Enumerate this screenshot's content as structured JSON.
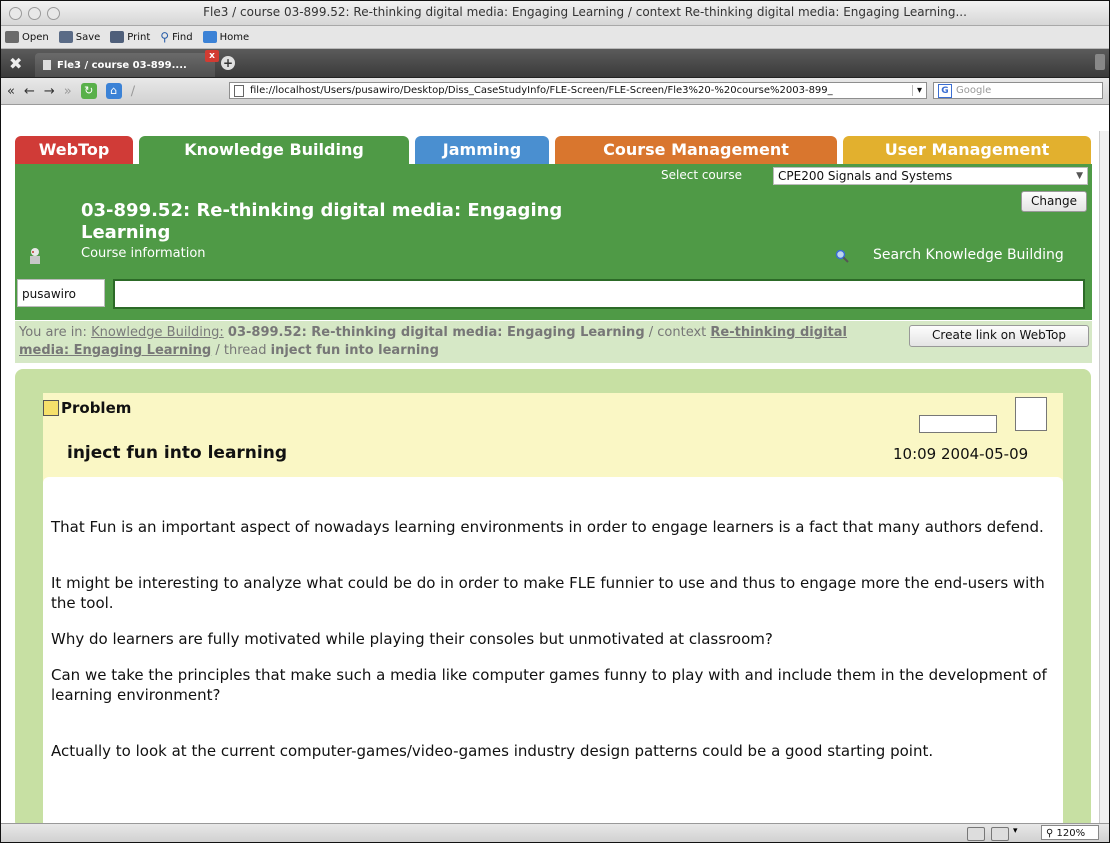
{
  "window": {
    "title": "Fle3 / course 03-899.52: Re-thinking digital media: Engaging Learning / context Re-thinking digital media: Engaging Learning..."
  },
  "bookmarks": [
    {
      "label": "Open",
      "icon": "folder-icon"
    },
    {
      "label": "Save",
      "icon": "save-icon"
    },
    {
      "label": "Print",
      "icon": "print-icon"
    },
    {
      "label": "Find",
      "icon": "search-icon"
    },
    {
      "label": "Home",
      "icon": "home-icon"
    }
  ],
  "browser_tab": {
    "label": "Fle3 / course 03-899....",
    "close": "x",
    "new_tab": "+"
  },
  "nav": {
    "url": "file://localhost/Users/pusawiro/Desktop/Diss_CaseStudyInfo/FLE-Screen/FLE-Screen/Fle3%20-%20course%2003-899_",
    "search_placeholder": "Google",
    "google_letter": "G"
  },
  "app_tabs": [
    {
      "label": "WebTop",
      "color": "#d03b37"
    },
    {
      "label": "Knowledge Building",
      "color": "#4f9a46"
    },
    {
      "label": "Jamming",
      "color": "#4a8fd0"
    },
    {
      "label": "Course Management",
      "color": "#d9762e"
    },
    {
      "label": "User Management",
      "color": "#e2b02e"
    }
  ],
  "course": {
    "select_label": "Select course",
    "selected": "CPE200 Signals and Systems",
    "change_label": "Change",
    "title": "03-899.52: Re-thinking digital media: Engaging Learning",
    "info": "Course information",
    "search_label": "Search Knowledge Building"
  },
  "user": {
    "name": "pusawiro",
    "input_value": ""
  },
  "breadcrumb": {
    "prefix": "You are in: ",
    "kb_link": "Knowledge Building:",
    "course": "03-899.52: Re-thinking digital media: Engaging Learning",
    "context_word": " / context ",
    "context_link": "Re-thinking digital media: Engaging Learning",
    "thread_word": " / thread ",
    "thread": "inject fun into learning",
    "create_link": "Create link on WebTop"
  },
  "note": {
    "type": "Problem",
    "title": "inject fun into learning",
    "date": "10:09 2004-05-09",
    "paragraphs": [
      "That Fun is an important aspect of nowadays learning environments in order to engage learners is a fact that many authors defend.",
      "It might be interesting to analyze what could be do in order to make FLE funnier to use and thus to engage more the end-users with the tool.",
      "Why do learners are fully motivated while playing their consoles but unmotivated at classroom?",
      "Can we take the principles that make such a media like computer games funny to play with and include them in the development of learning environment?",
      "Actually to look at the current computer-games/video-games industry design patterns could be a good starting point."
    ]
  },
  "status": {
    "zoom": "120%"
  }
}
